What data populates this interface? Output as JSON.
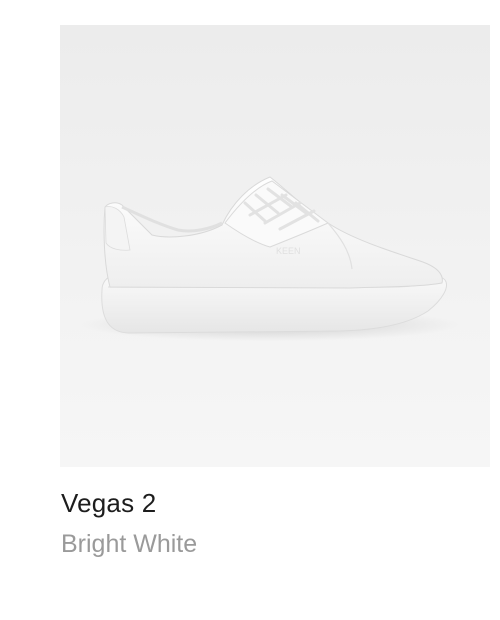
{
  "product": {
    "name": "Vegas 2",
    "color_name": "Bright White",
    "image_icon": "white-sneaker-image",
    "logo_text": "KEEN"
  },
  "colors": {
    "image_background": "#efefef",
    "name_text": "#1d1d1d",
    "color_text": "#9a9a9a"
  }
}
